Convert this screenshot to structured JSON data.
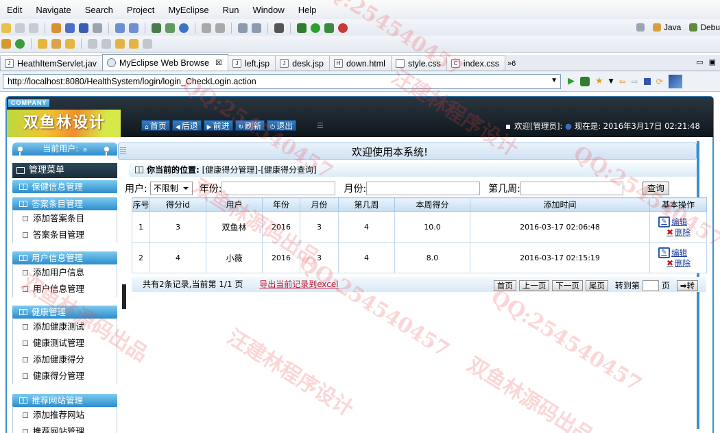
{
  "ide": {
    "menu": [
      "Edit",
      "Navigate",
      "Search",
      "Project",
      "MyEclipse",
      "Run",
      "Window",
      "Help"
    ],
    "perspectives": [
      "Java",
      "Debu"
    ],
    "tabs": [
      {
        "label": "HeathItemServlet.jav",
        "icon": "java-file-icon"
      },
      {
        "label": "MyEclipse Web Browse",
        "icon": "browser-globe-icon",
        "active": true
      },
      {
        "label": "left.jsp",
        "icon": "jsp-file-icon"
      },
      {
        "label": "desk.jsp",
        "icon": "jsp-file-icon"
      },
      {
        "label": "down.html",
        "icon": "html-file-icon"
      },
      {
        "label": "style.css",
        "icon": "css-file-icon"
      },
      {
        "label": "index.css",
        "icon": "css-file-icon"
      }
    ],
    "tab_overflow": "»6",
    "url": "http://localhost:8080/HealthSystem/login/login_CheckLogin.action"
  },
  "banner": {
    "company": "COMPANY",
    "logo": "双鱼林设计",
    "nav": [
      {
        "label": "首页",
        "icon": "home-icon"
      },
      {
        "label": "后退",
        "icon": "back-arrow-icon"
      },
      {
        "label": "前进",
        "icon": "forward-arrow-icon"
      },
      {
        "label": "刷新",
        "icon": "refresh-icon"
      },
      {
        "label": "退出",
        "icon": "power-icon"
      }
    ],
    "welcome": "欢迎[管理员]:",
    "now": "现在是: 2016年3月17日 02:21:48"
  },
  "sidebar": {
    "current_user": "当前用户:",
    "current_user_dot": "a",
    "menu_title": "管理菜单",
    "groups": [
      {
        "title": "保健信息管理",
        "items": []
      },
      {
        "title": "答案条目管理",
        "items": [
          "添加答案条目",
          "答案条目管理"
        ]
      },
      {
        "title": "用户信息管理",
        "items": [
          "添加用户信息",
          "用户信息管理"
        ]
      },
      {
        "title": "健康管理",
        "items": [
          "添加健康测试",
          "健康测试管理",
          "添加健康得分",
          "健康得分管理"
        ]
      },
      {
        "title": "推荐网站管理",
        "items": [
          "添加推荐网站",
          "推荐网站管理"
        ]
      }
    ]
  },
  "main": {
    "title": "欢迎使用本系统!",
    "location_label": "你当前的位置:",
    "location": "[健康得分管理]-[健康得分查询]",
    "search": {
      "user_label": "用户:",
      "user_value": "不限制",
      "year_label": "年份:",
      "month_label": "月份:",
      "week_label": "第几周:",
      "query_button": "查询"
    },
    "table": {
      "headers": [
        "序号",
        "得分id",
        "用户",
        "年份",
        "月份",
        "第几周",
        "本周得分",
        "添加时间",
        "基本操作"
      ],
      "rows": [
        [
          "1",
          "3",
          "双鱼林",
          "2016",
          "3",
          "4",
          "10.0",
          "2016-03-17 02:06:48"
        ],
        [
          "2",
          "4",
          "小薇",
          "2016",
          "3",
          "4",
          "8.0",
          "2016-03-17 02:15:19"
        ]
      ],
      "edit_label": "编辑",
      "delete_label": "删除"
    },
    "footer": {
      "summary": "共有2条记录,当前第 1/1 页",
      "export": "导出当前记录到excel",
      "first": "首页",
      "prev": "上一页",
      "next": "下一页",
      "last": "尾页",
      "goto": "转到第",
      "page_unit": "页",
      "go": "转"
    }
  },
  "watermarks": [
    "QQ:254540457",
    "汪建林程序设计",
    "双鱼林源码出品"
  ]
}
